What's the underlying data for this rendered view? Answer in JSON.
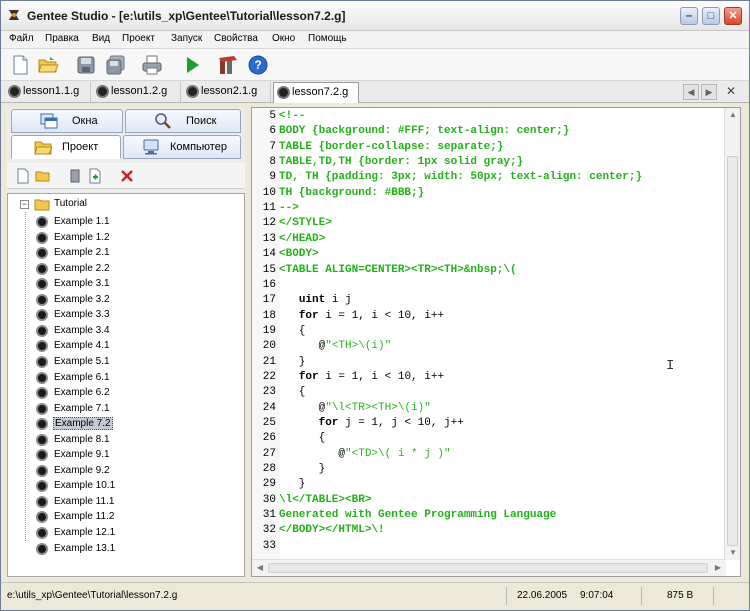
{
  "window": {
    "title": "Gentee Studio - [e:\\utils_xp\\Gentee\\Tutorial\\lesson7.2.g]",
    "controls": {
      "minimize": "‒",
      "maximize": "□",
      "close": "✕"
    }
  },
  "menu": [
    "Файл",
    "Правка",
    "Вид",
    "Проект",
    "Запуск",
    "Свойства",
    "Окно",
    "Помощь"
  ],
  "toolbar": {
    "buttons": [
      "new-file-icon",
      "open-folder-icon",
      "save-icon",
      "save-all-icon",
      "print-icon",
      "run-icon",
      "build-icon",
      "help-icon"
    ]
  },
  "tabs": [
    {
      "label": "lesson1.1.g",
      "active": false
    },
    {
      "label": "lesson1.2.g",
      "active": false
    },
    {
      "label": "lesson2.1.g",
      "active": false
    },
    {
      "label": "lesson7.2.g",
      "active": true
    }
  ],
  "tabnav": {
    "prev": "◀",
    "next": "▶",
    "close": "✕"
  },
  "panel_tabs": {
    "windows": "Окна",
    "search": "Поиск",
    "project": "Проект",
    "computer": "Компьютер"
  },
  "tree": {
    "root": "Tutorial",
    "items": [
      "Example 1.1",
      "Example 1.2",
      "Example 2.1",
      "Example 2.2",
      "Example 3.1",
      "Example 3.2",
      "Example 3.3",
      "Example 3.4",
      "Example 4.1",
      "Example 5.1",
      "Example 6.1",
      "Example 6.2",
      "Example 7.1",
      "Example 7.2",
      "Example 8.1",
      "Example 9.1",
      "Example 9.2",
      "Example 10.1",
      "Example 11.1",
      "Example 11.2",
      "Example 12.1",
      "Example 13.1"
    ],
    "selected": "Example 7.2"
  },
  "editor": {
    "lines": [
      {
        "n": "5",
        "text": "<!--",
        "style": "green"
      },
      {
        "n": "6",
        "text": "BODY {background: #FFF; text-align: center;}",
        "style": "green"
      },
      {
        "n": "7",
        "text": "TABLE {border-collapse: separate;}",
        "style": "green"
      },
      {
        "n": "8",
        "text": "TABLE,TD,TH {border: 1px solid gray;}",
        "style": "green"
      },
      {
        "n": "9",
        "text": "TD, TH {padding: 3px; width: 50px; text-align: center;}",
        "style": "green"
      },
      {
        "n": "10",
        "text": "TH {background: #BBB;}",
        "style": "green"
      },
      {
        "n": "11",
        "text": "-->",
        "style": "green"
      },
      {
        "n": "12",
        "text": "</STYLE>",
        "style": "green"
      },
      {
        "n": "13",
        "text": "</HEAD>",
        "style": "green"
      },
      {
        "n": "14",
        "text": "<BODY>",
        "style": "green"
      },
      {
        "n": "15",
        "text": "<TABLE ALIGN=CENTER><TR><TH>&nbsp;\\(",
        "style": "green"
      },
      {
        "n": "16",
        "text": "",
        "style": "plain"
      },
      {
        "n": "17",
        "text": "   uint i j",
        "style": "plain"
      },
      {
        "n": "18",
        "text": "   for i = 1, i < 10, i++",
        "style": "plain"
      },
      {
        "n": "19",
        "text": "   {",
        "style": "plain"
      },
      {
        "n": "20",
        "text": "      @\"<TH>\\(i)\"",
        "style": "plain"
      },
      {
        "n": "21",
        "text": "   }",
        "style": "plain"
      },
      {
        "n": "22",
        "text": "   for i = 1, i < 10, i++",
        "style": "plain"
      },
      {
        "n": "23",
        "text": "   {",
        "style": "plain"
      },
      {
        "n": "24",
        "text": "      @\"\\l<TR><TH>\\(i)\"",
        "style": "plain"
      },
      {
        "n": "25",
        "text": "      for j = 1, j < 10, j++",
        "style": "plain"
      },
      {
        "n": "26",
        "text": "      {",
        "style": "plain"
      },
      {
        "n": "27",
        "text": "         @\"<TD>\\( i * j )\"",
        "style": "plain"
      },
      {
        "n": "28",
        "text": "      }",
        "style": "plain"
      },
      {
        "n": "29",
        "text": "   }",
        "style": "plain"
      },
      {
        "n": "30",
        "text": "\\l</TABLE><BR>",
        "style": "green"
      },
      {
        "n": "31",
        "text": "Generated with Gentee Programming Language",
        "style": "green"
      },
      {
        "n": "32",
        "text": "</BODY></HTML>\\!",
        "style": "green"
      },
      {
        "n": "33",
        "text": "",
        "style": "plain"
      }
    ],
    "text_cursor": "I"
  },
  "status": {
    "path": "e:\\utils_xp\\Gentee\\Tutorial\\lesson7.2.g",
    "date": "22.06.2005",
    "time": "9:07:04",
    "size": "875 B"
  },
  "colors": {
    "code_green": "#23b11a",
    "selection": "#c6cad4",
    "window_bg": "#ece9d8"
  }
}
